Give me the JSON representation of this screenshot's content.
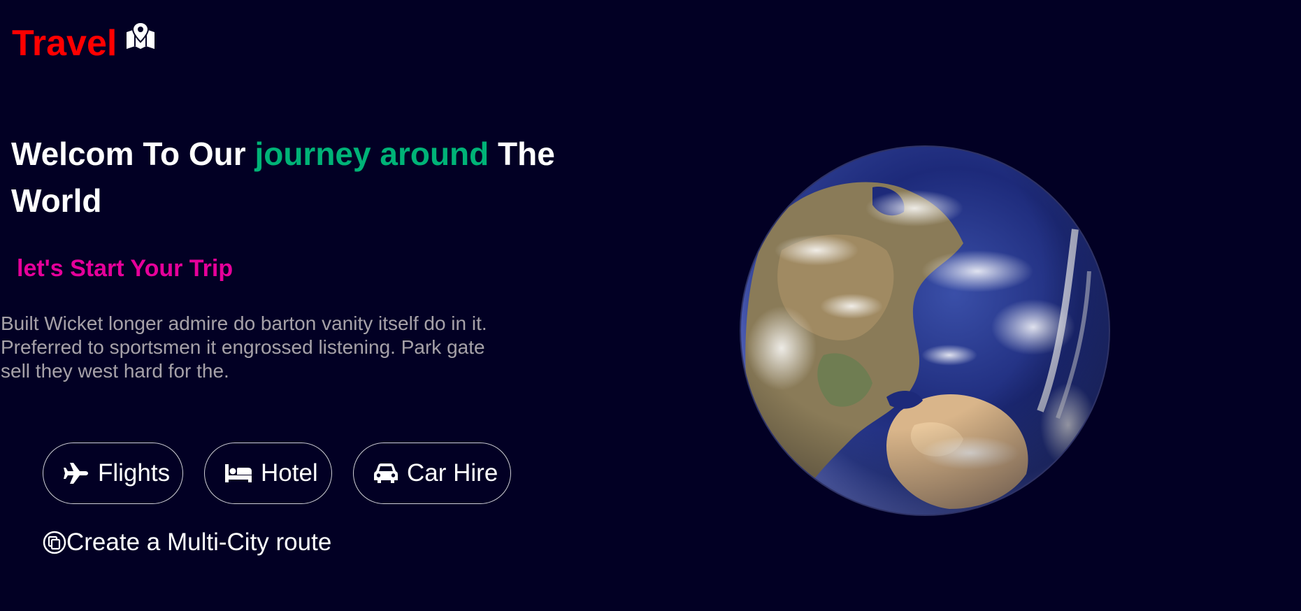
{
  "brand": {
    "title": "Travel",
    "icon": "map-location-icon",
    "color": "#ff0000"
  },
  "hero": {
    "headline_part1": "Welcom To Our ",
    "headline_accent": "journey around",
    "headline_part2": " The World",
    "accent_color": "#00b377",
    "subheading": "let's Start Your Trip",
    "subheading_color": "#e6009a",
    "description": "Built Wicket longer admire do barton vanity itself do in it. Preferred to sportsmen it engrossed listening. Park gate sell they west hard for the."
  },
  "options": [
    {
      "label": "Flights",
      "icon": "plane-icon"
    },
    {
      "label": "Hotel",
      "icon": "bed-icon"
    },
    {
      "label": "Car Hire",
      "icon": "car-icon"
    }
  ],
  "multi_city": {
    "label": "Create a Multi-City route",
    "icon": "copy-icon"
  },
  "image": {
    "name": "earth-globe",
    "background": "#020024"
  }
}
